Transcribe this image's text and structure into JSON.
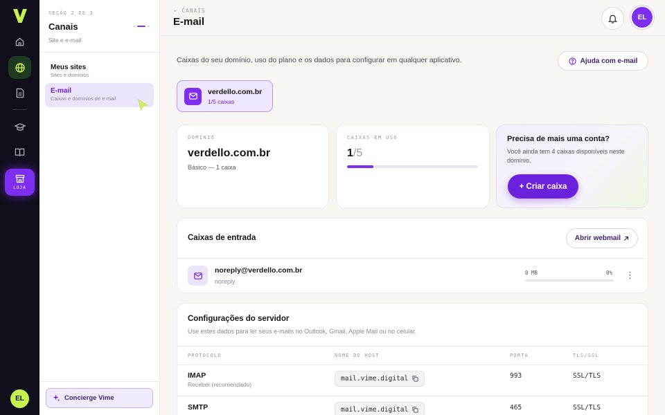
{
  "rail": {
    "store_label": "LOJA",
    "avatar_initials": "EL",
    "accent": "#7d2ef0",
    "brand": "#c6f24e"
  },
  "sidebar": {
    "section": "SEÇÃO 2 DE 3",
    "title": "Canais",
    "subtitle": "Site e e-mail",
    "items": [
      {
        "label": "Meus sites",
        "sub": "Sites e domínios"
      },
      {
        "label": "E-mail",
        "sub": "Caixas e domínios de e-mail"
      }
    ],
    "concierge": "Concierge Vime"
  },
  "header": {
    "breadcrumb": "← CANAIS",
    "title": "E-mail",
    "avatar_initials": "EL"
  },
  "main": {
    "intro": "Caixas do seu domínio, uso do plano e os dados para configurar em qualquer aplicativo.",
    "help_button": "Ajuda com e-mail",
    "domain_chip": {
      "name": "verdello.com.br",
      "count": "1/5 caixas"
    },
    "domain_card": {
      "label": "DOMÍNIO",
      "value": "verdello.com.br",
      "plan": "Básico — 1 caixa"
    },
    "usage_card": {
      "label": "CAIXAS EM USO",
      "used": "1",
      "total": "/5",
      "fraction": 0.2
    },
    "cta_card": {
      "title": "Precisa de mais uma conta?",
      "text": "Você ainda tem 4 caixas disponíveis neste domínio.",
      "button": "+ Criar caixa"
    },
    "inbox": {
      "title": "Caixas de entrada",
      "webmail_button": "Abrir webmail",
      "mailboxes": [
        {
          "address": "noreply@verdello.com.br",
          "user": "noreply",
          "size": "0 MB",
          "percent": "0%",
          "fraction": 0
        }
      ]
    },
    "server": {
      "title": "Configurações do servidor",
      "description": "Use estes dados para ler seus e-mails no Outlook, Gmail, Apple Mail ou no celular.",
      "columns": [
        "PROTOCOLO",
        "NOME DO HOST",
        "PORTA",
        "TLS/SSL"
      ],
      "rows": [
        {
          "protocol": "IMAP",
          "note": "Receber (recomendado)",
          "host": "mail.vime.digital",
          "port": "993",
          "tls": "SSL/TLS"
        },
        {
          "protocol": "SMTP",
          "note": "",
          "host": "mail.vime.digital",
          "port": "465",
          "tls": "SSL/TLS"
        }
      ]
    }
  }
}
